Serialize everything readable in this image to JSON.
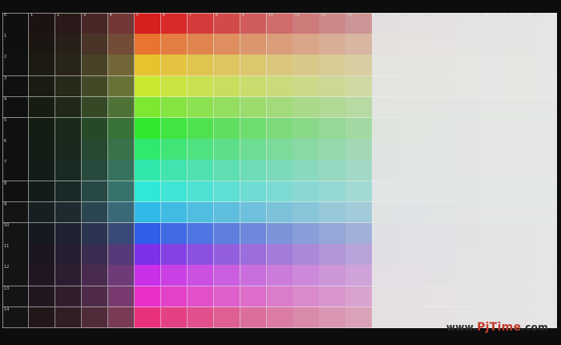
{
  "scene": {
    "column_labels": [
      "0",
      "1",
      "2",
      "3",
      "4",
      "5",
      "6",
      "7",
      "8",
      "9",
      "10",
      "11",
      "12",
      "13",
      "14",
      "15",
      "16",
      "17",
      "18",
      "19",
      "20"
    ],
    "row_labels": [
      "0",
      "1",
      "2",
      "3",
      "4",
      "5",
      "6",
      "7",
      "8",
      "9",
      "10",
      "11",
      "12",
      "13",
      "14"
    ],
    "watermark": {
      "prefix": "www.",
      "brand": "PjTime",
      "suffix": ".com"
    }
  }
}
